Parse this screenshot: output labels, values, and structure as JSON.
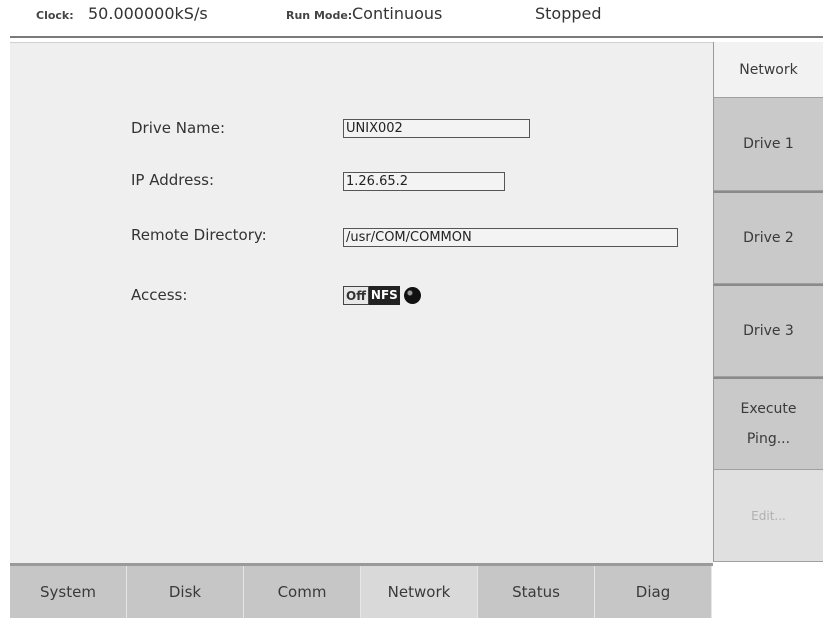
{
  "status": {
    "clock_label": "Clock:",
    "clock_value": "50.000000kS/s",
    "run_mode_label": "Run Mode:",
    "run_mode_value": "Continuous",
    "state": "Stopped"
  },
  "form": {
    "drive_name": {
      "label": "Drive Name:",
      "value": "UNIX002"
    },
    "ip_address": {
      "label": "IP Address:",
      "value": "1.26.65.2"
    },
    "remote_directory": {
      "label": "Remote Directory:",
      "value": "/usr/COM/COMMON"
    },
    "access": {
      "label": "Access:",
      "options": [
        "Off",
        "NFS"
      ],
      "selected": "NFS"
    }
  },
  "side_menu": {
    "network": "Network",
    "drive1": "Drive 1",
    "drive2": "Drive 2",
    "drive3": "Drive 3",
    "execute_ping_line1": "Execute",
    "execute_ping_line2": "Ping...",
    "edit": "Edit..."
  },
  "tabs": [
    "System",
    "Disk",
    "Comm",
    "Network",
    "Status",
    "Diag"
  ],
  "active_tab": "Network",
  "colors": {
    "tab_bg": "#c6c6c6",
    "panel_bg": "#efefef",
    "side_button_bg": "#c9c9c9"
  }
}
